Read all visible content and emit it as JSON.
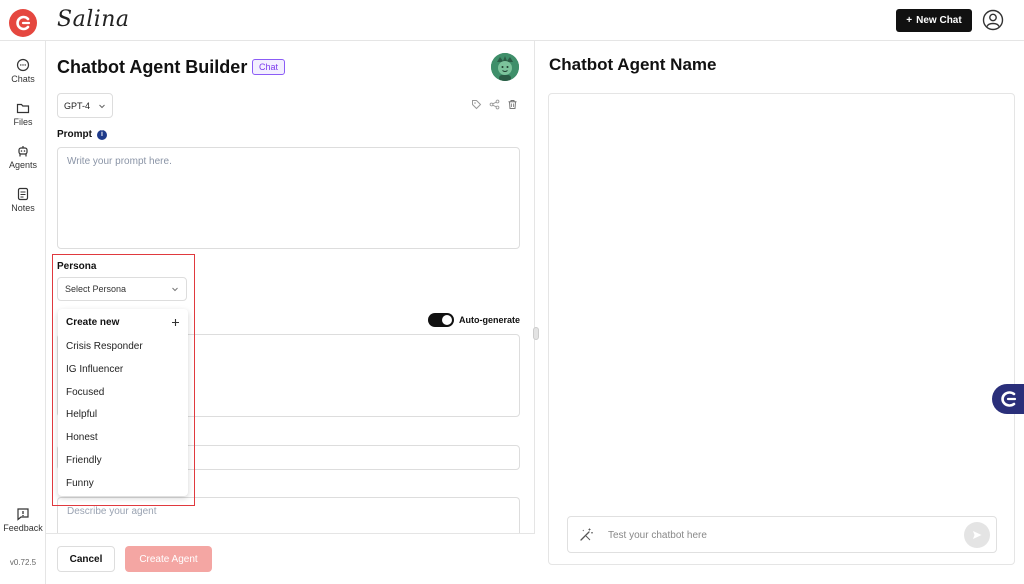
{
  "brand": {
    "name": "Salina"
  },
  "header": {
    "new_chat_label": "New Chat"
  },
  "nav": {
    "items": [
      {
        "label": "Chats",
        "icon": "chat-bubble-icon"
      },
      {
        "label": "Files",
        "icon": "folder-icon"
      },
      {
        "label": "Agents",
        "icon": "robot-icon"
      },
      {
        "label": "Notes",
        "icon": "notes-icon"
      }
    ],
    "feedback_label": "Feedback",
    "version": "v0.72.5"
  },
  "builder": {
    "title": "Chatbot Agent Builder",
    "badge": "Chat",
    "model": "GPT-4",
    "prompt_label": "Prompt",
    "prompt_placeholder": "Write your prompt here.",
    "persona_label": "Persona",
    "persona_select": "Select Persona",
    "persona_create_label": "Create new",
    "persona_options": [
      "Crisis Responder",
      "IG Influencer",
      "Focused",
      "Helpful",
      "Honest",
      "Friendly",
      "Funny"
    ],
    "autogenerate_label": "Auto-generate",
    "autogenerate_on": true,
    "describe_placeholder": "Describe your agent",
    "cancel_label": "Cancel",
    "create_label": "Create Agent"
  },
  "preview": {
    "title": "Chatbot Agent Name",
    "input_placeholder": "Test your chatbot here"
  },
  "colors": {
    "brand_red": "#e5473f",
    "badge_purple": "#7c3aed",
    "create_disabled": "#f4a6a3",
    "float_navy": "#2a2f7a"
  }
}
